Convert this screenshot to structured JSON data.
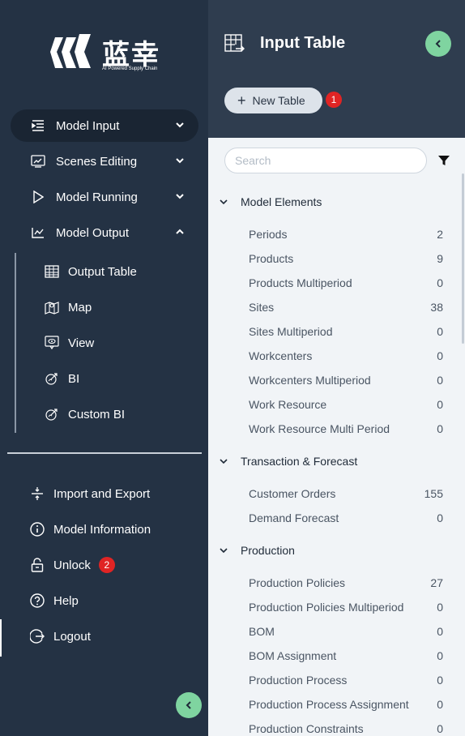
{
  "brand": {
    "name_cn": "蓝幸",
    "tagline": "AI Powered Supply Chain"
  },
  "sidebar": {
    "nav": [
      {
        "label": "Model Input",
        "icon": "list-indent-icon",
        "expanded": false,
        "active": true
      },
      {
        "label": "Scenes Editing",
        "icon": "chart-edit-icon",
        "expanded": false
      },
      {
        "label": "Model Running",
        "icon": "play-icon",
        "expanded": false
      },
      {
        "label": "Model Output",
        "icon": "line-chart-icon",
        "expanded": true
      }
    ],
    "output_sub": [
      {
        "label": "Output Table",
        "icon": "table-icon"
      },
      {
        "label": "Map",
        "icon": "map-icon"
      },
      {
        "label": "View",
        "icon": "view-icon"
      },
      {
        "label": "BI",
        "icon": "bi-icon"
      },
      {
        "label": "Custom BI",
        "icon": "custom-bi-icon"
      }
    ],
    "bottom": [
      {
        "label": "Import and Export",
        "icon": "import-export-icon"
      },
      {
        "label": "Model Information",
        "icon": "info-icon"
      },
      {
        "label": "Unlock",
        "icon": "unlock-icon",
        "badge": "2"
      },
      {
        "label": "Help",
        "icon": "help-icon"
      },
      {
        "label": "Logout",
        "icon": "logout-icon"
      }
    ]
  },
  "panel": {
    "title": "Input Table",
    "new_table_label": "New Table",
    "new_table_badge": "1",
    "search_placeholder": "Search",
    "groups": [
      {
        "title": "Model Elements",
        "rows": [
          {
            "label": "Periods",
            "count": "2"
          },
          {
            "label": "Products",
            "count": "9"
          },
          {
            "label": "Products Multiperiod",
            "count": "0"
          },
          {
            "label": "Sites",
            "count": "38"
          },
          {
            "label": "Sites Multiperiod",
            "count": "0"
          },
          {
            "label": "Workcenters",
            "count": "0"
          },
          {
            "label": "Workcenters Multiperiod",
            "count": "0"
          },
          {
            "label": "Work Resource",
            "count": "0"
          },
          {
            "label": "Work Resource Multi Period",
            "count": "0"
          }
        ]
      },
      {
        "title": "Transaction & Forecast",
        "rows": [
          {
            "label": "Customer Orders",
            "count": "155"
          },
          {
            "label": "Demand Forecast",
            "count": "0"
          }
        ]
      },
      {
        "title": "Production",
        "rows": [
          {
            "label": "Production Policies",
            "count": "27"
          },
          {
            "label": "Production Policies Multiperiod",
            "count": "0"
          },
          {
            "label": "BOM",
            "count": "0"
          },
          {
            "label": "BOM Assignment",
            "count": "0"
          },
          {
            "label": "Production Process",
            "count": "0"
          },
          {
            "label": "Production Process Assignment",
            "count": "0"
          },
          {
            "label": "Production Constraints",
            "count": "0"
          }
        ]
      }
    ]
  },
  "colors": {
    "sidebar_bg": "#243244",
    "header_bg": "#2f3d4f",
    "body_bg": "#f1f4f7",
    "accent_green": "#7fd4a0",
    "badge_red": "#e02424"
  }
}
